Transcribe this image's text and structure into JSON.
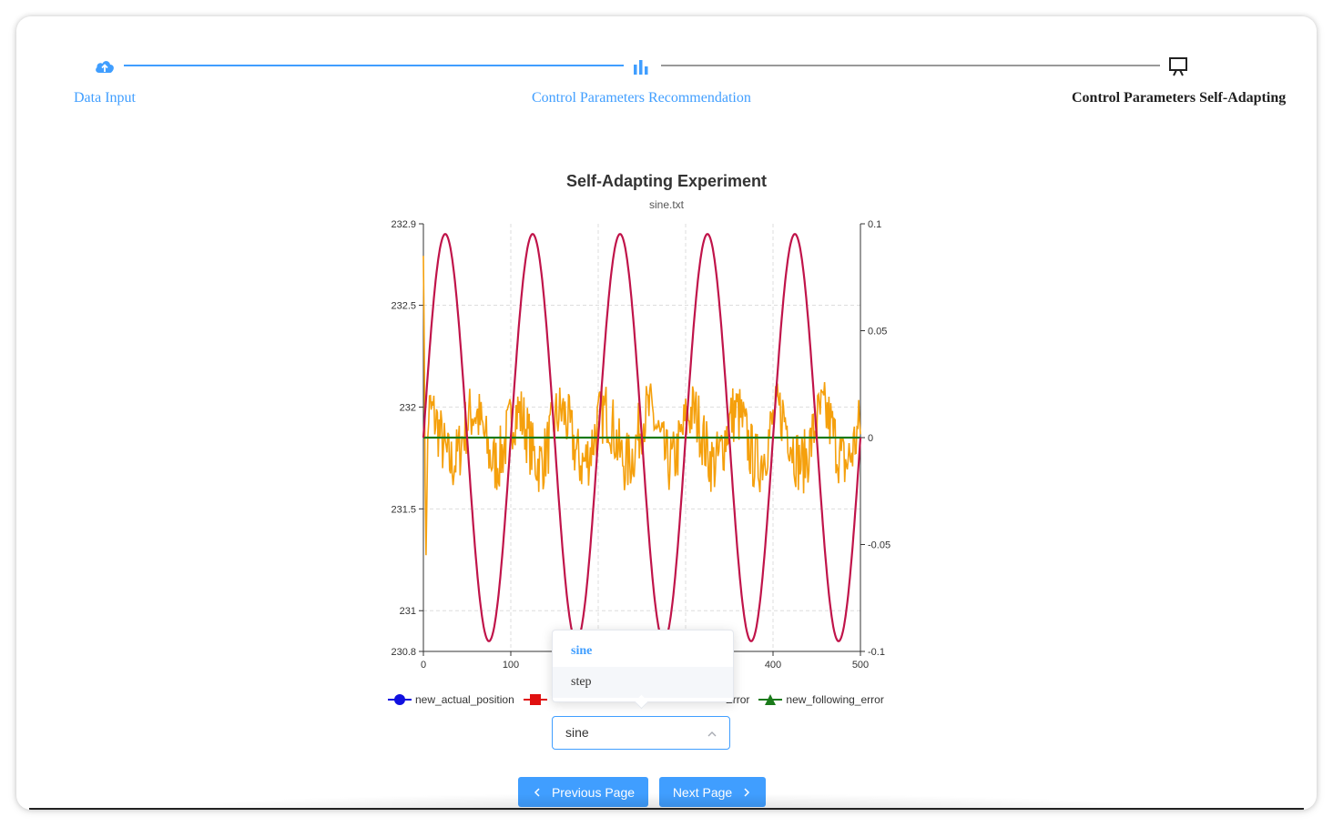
{
  "steps": [
    {
      "label": "Data Input",
      "icon": "cloud-upload-icon",
      "state": "done"
    },
    {
      "label": "Control Parameters Recommendation",
      "icon": "bar-chart-icon",
      "state": "done"
    },
    {
      "label": "Control Parameters Self-Adapting",
      "icon": "presentation-icon",
      "state": "active"
    }
  ],
  "colors": {
    "accent": "#409eff",
    "sine": "#c0144a",
    "noise": "#f5a00c",
    "zero_line": "#1a7a1a",
    "text_active": "#1f1f1f"
  },
  "chart_data": {
    "type": "line",
    "title": "Self-Adapting Experiment",
    "subtitle": "sine.txt",
    "x_ticks": [
      "0",
      "100",
      "200",
      "300",
      "400",
      "500"
    ],
    "xlim": [
      0,
      500
    ],
    "y_left_ticks": [
      "232.9",
      "232.5",
      "232",
      "231.5",
      "231",
      "230.8"
    ],
    "y_left_range": [
      230.8,
      232.9
    ],
    "y_right_ticks": [
      "0.1",
      "0.05",
      "0",
      "-0.05",
      "-0.1"
    ],
    "y_right_range": [
      -0.1,
      0.1
    ],
    "grid": true,
    "series": [
      {
        "name": "new_actual_position",
        "color": "#1010e0",
        "marker": "circle",
        "axis": "left",
        "values_desc": "sine, period 100, amplitude 1.0, center 231.85",
        "amplitude": 1.0,
        "center": 231.85,
        "period": 100
      },
      {
        "name": "",
        "color": "#e01010",
        "marker": "square",
        "axis": "left"
      },
      {
        "name": "",
        "color": "#f5a00c",
        "marker": "square",
        "axis": "right"
      },
      {
        "name": "new_following_error",
        "color": "#1a7a1a",
        "marker": "triangle",
        "axis": "right",
        "value": 0
      }
    ],
    "legend_visible_text": [
      "new_actual_position",
      "-Error",
      "new_following_error"
    ]
  },
  "select": {
    "value": "sine",
    "options": [
      "sine",
      "step"
    ]
  },
  "buttons": {
    "prev": "Previous Page",
    "next": "Next Page"
  }
}
